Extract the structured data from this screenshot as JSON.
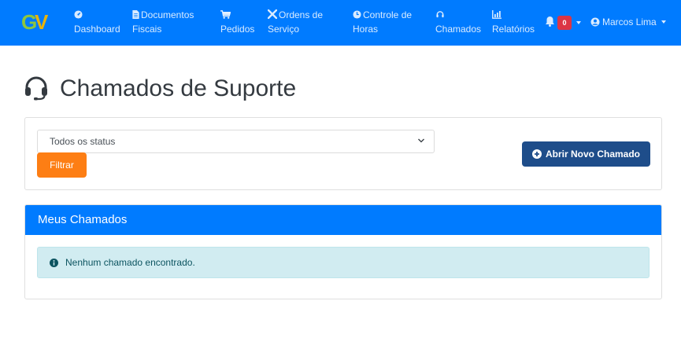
{
  "navbar": {
    "brand_text": "GV",
    "items": [
      {
        "icon": "gauge-icon",
        "line1": "",
        "line2": "Dashboard"
      },
      {
        "icon": "document-icon",
        "line1": "Documentos",
        "line2": "Fiscais"
      },
      {
        "icon": "cart-icon",
        "line1": "",
        "line2": "Pedidos"
      },
      {
        "icon": "tools-icon",
        "line1": "Ordens de",
        "line2": "Serviço"
      },
      {
        "icon": "clock-icon",
        "line1": "Controle de",
        "line2": "Horas"
      },
      {
        "icon": "headset-icon",
        "line1": "",
        "line2": "Chamados"
      },
      {
        "icon": "chart-icon",
        "line1": "",
        "line2": "Relatórios"
      }
    ],
    "notifications_count": "0",
    "user_name": "Marcos Lima"
  },
  "page": {
    "title": "Chamados de Suporte"
  },
  "filter": {
    "status_selected": "Todos os status",
    "filter_button": "Filtrar",
    "new_ticket_button": "Abrir Novo Chamado"
  },
  "tickets": {
    "header": "Meus Chamados",
    "empty_message": "Nenhum chamado encontrado."
  },
  "colors": {
    "primary": "#007bff",
    "filter_button": "#fd7e14",
    "new_button": "#1e4d8a",
    "badge": "#dc3545",
    "alert_bg": "#d1ecf1",
    "alert_text": "#0c5460"
  }
}
